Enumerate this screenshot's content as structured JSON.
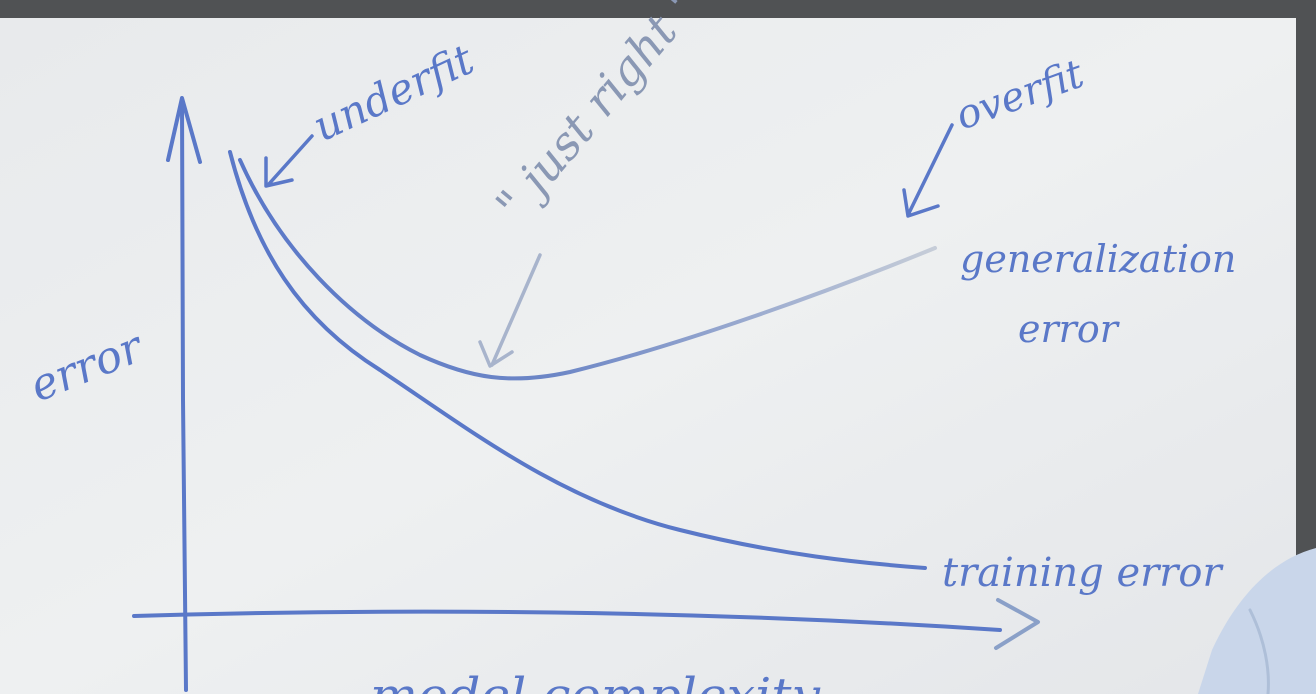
{
  "board": {
    "ink_color": "#5a78c8",
    "faded_ink_color": "#a8b4cc",
    "surface_color": "#eceef0"
  },
  "labels": {
    "y_axis": "error",
    "underfit": "underfit",
    "just_right": "\" just right \"",
    "overfit": "overfit",
    "generalization_line1": "generalization",
    "generalization_line2": "error",
    "training": "training error",
    "x_axis": "model complexity"
  }
}
